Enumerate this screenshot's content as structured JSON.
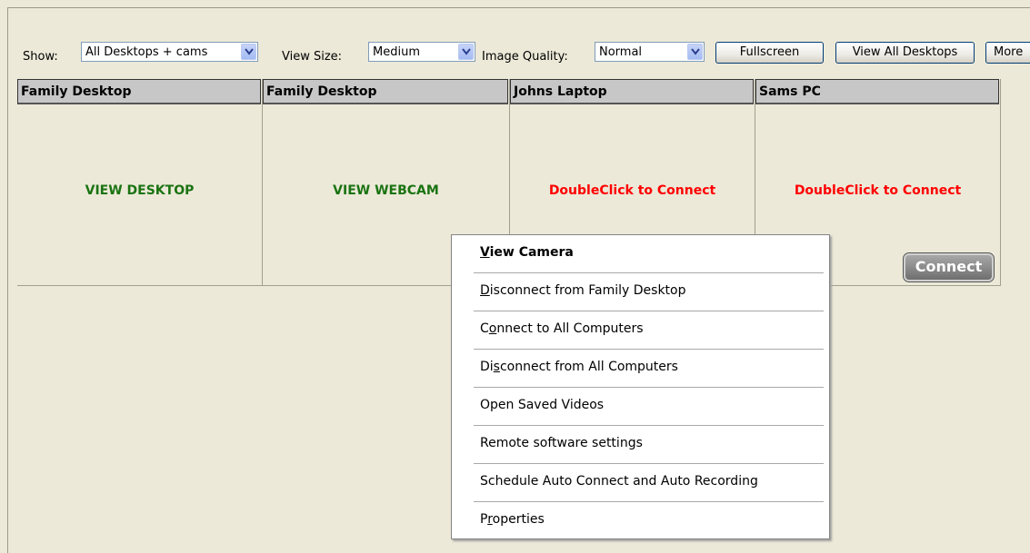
{
  "toolbar": {
    "show_label": "Show:",
    "show_value": "All Desktops + cams",
    "viewsize_label": "View Size:",
    "viewsize_value": "Medium",
    "quality_label": "Image Quality:",
    "quality_value": "Normal",
    "fullscreen_label": "Fullscreen",
    "view_all_label": "View All Desktops",
    "more_label": "More"
  },
  "tiles": [
    {
      "title": "Family Desktop",
      "status": "VIEW DESKTOP"
    },
    {
      "title": "Family Desktop",
      "status": "VIEW WEBCAM"
    },
    {
      "title": "Johns Laptop",
      "status": "DoubleClick to Connect"
    },
    {
      "title": "Sams PC",
      "status": "DoubleClick to Connect"
    }
  ],
  "connect_button": "Connect",
  "context_menu": {
    "items": [
      {
        "pre": "",
        "key": "V",
        "post": "iew Camera"
      },
      {
        "pre": "",
        "key": "D",
        "post": "isconnect from Family Desktop"
      },
      {
        "pre": "C",
        "key": "o",
        "post": "nnect to All Computers"
      },
      {
        "pre": "Di",
        "key": "s",
        "post": "connect from All Computers"
      },
      {
        "pre": "Open Saved Videos",
        "key": "",
        "post": ""
      },
      {
        "pre": "Remote software settings",
        "key": "",
        "post": ""
      },
      {
        "pre": "Schedule Auto Connect and Auto Recording",
        "key": "",
        "post": ""
      },
      {
        "pre": "P",
        "key": "r",
        "post": "operties"
      }
    ]
  },
  "colors": {
    "background": "#ece9d8",
    "status_ok": "#1a7312",
    "status_connect": "#ff0000"
  }
}
